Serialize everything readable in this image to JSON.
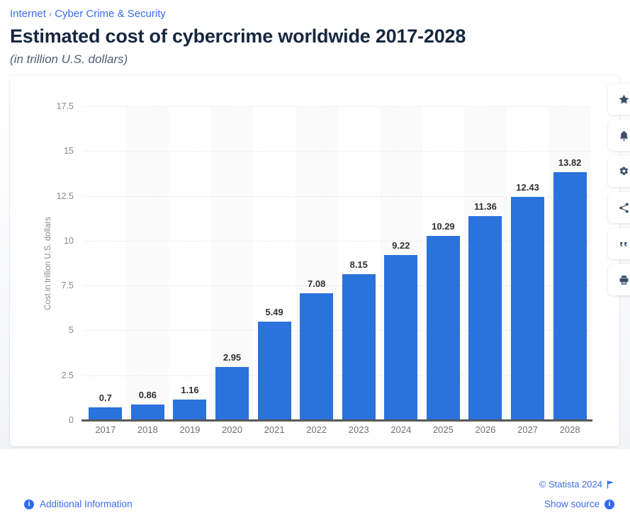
{
  "breadcrumb": {
    "items": [
      {
        "label": "Internet"
      },
      {
        "label": "Cyber Crime & Security"
      }
    ],
    "separator": "›"
  },
  "header": {
    "title": "Estimated cost of cybercrime worldwide 2017-2028",
    "subtitle": "(in trillion U.S. dollars)"
  },
  "toolbar": {
    "buttons": [
      {
        "name": "favorite-star-icon",
        "label": "star-icon"
      },
      {
        "name": "notification-bell-icon",
        "label": "bell-icon"
      },
      {
        "name": "settings-gear-icon",
        "label": "gear-icon"
      },
      {
        "name": "share-icon",
        "label": "share-icon"
      },
      {
        "name": "citation-quote-icon",
        "label": "quote-icon"
      },
      {
        "name": "print-icon",
        "label": "print-icon"
      }
    ]
  },
  "footer": {
    "copyright": "© Statista 2024",
    "show_source": "Show source",
    "additional_information": "Additional Information",
    "info_glyph": "i"
  },
  "colors": {
    "bar": "#2a72dc",
    "link": "#3c6df0",
    "title": "#16273f",
    "subtitle": "#4d6075",
    "axis_text": "#8a8a8d",
    "value_label": "#2f3132",
    "band_shaded": "#fafafa",
    "icon": "#3b5068"
  },
  "chart_data": {
    "type": "bar",
    "title": "Estimated cost of cybercrime worldwide 2017-2028",
    "subtitle": "(in trillion U.S. dollars)",
    "xlabel": "",
    "ylabel": "Cost in trillion U.S. dollars",
    "categories": [
      "2017",
      "2018",
      "2019",
      "2020",
      "2021",
      "2022",
      "2023",
      "2024",
      "2025",
      "2026",
      "2027",
      "2028"
    ],
    "values": [
      0.7,
      0.86,
      1.16,
      2.95,
      5.49,
      7.08,
      8.15,
      9.22,
      10.29,
      11.36,
      12.43,
      13.82
    ],
    "value_labels": [
      "0.7",
      "0.86",
      "1.16",
      "2.95",
      "5.49",
      "7.08",
      "8.15",
      "9.22",
      "10.29",
      "11.36",
      "12.43",
      "13.82"
    ],
    "ylim": [
      0,
      17.5
    ],
    "yticks": [
      0,
      2.5,
      5,
      7.5,
      10,
      12.5,
      15,
      17.5
    ],
    "ytick_labels": [
      "0",
      "2.5",
      "5",
      "7.5",
      "10",
      "12.5",
      "15",
      "17.5"
    ],
    "grid": true,
    "legend": false,
    "series": [
      {
        "name": "Estimated cost of cybercrime worldwide",
        "values": [
          0.7,
          0.86,
          1.16,
          2.95,
          5.49,
          7.08,
          8.15,
          9.22,
          10.29,
          11.36,
          12.43,
          13.82
        ]
      }
    ]
  }
}
